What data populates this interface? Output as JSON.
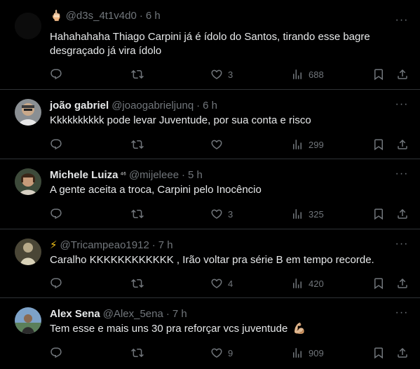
{
  "tweets": [
    {
      "prefix_emoji": "🖕🏻",
      "name": "",
      "handle": "@d3s_4t1v4d0",
      "time": "6 h",
      "text": "Hahahahaha Thiago Carpini já é ídolo do Santos, tirando esse bagre desgraçado já vira ídolo",
      "replies": "",
      "retweets": "",
      "likes": "3",
      "views": "688"
    },
    {
      "prefix_emoji": "",
      "name": "joão gabriel",
      "handle": "@joaogabrieljunq",
      "time": "6 h",
      "text": "Kkkkkkkkkk pode levar Juventude, por sua conta e risco",
      "replies": "",
      "retweets": "",
      "likes": "",
      "views": "299"
    },
    {
      "prefix_emoji": "",
      "name": "Michele Luiza",
      "name_suffix": "⁴⁶",
      "handle": "@mijeleee",
      "time": "5 h",
      "text": "A gente aceita a troca, Carpini pelo Inocêncio",
      "replies": "",
      "retweets": "",
      "likes": "3",
      "views": "325"
    },
    {
      "prefix_emoji": "⚡",
      "name": "",
      "handle": "@Tricampeao1912",
      "time": "7 h",
      "text": "Caralho KKKKKKKKKKKK , Irão voltar pra série B em tempo recorde.",
      "replies": "",
      "retweets": "",
      "likes": "4",
      "views": "420"
    },
    {
      "prefix_emoji": "",
      "name": "Alex Sena",
      "handle": "@Alex_5ena",
      "time": "7 h",
      "text": "Tem esse e mais uns 30 pra reforçar vcs juventude",
      "text_emoji": "💪🏼",
      "replies": "",
      "retweets": "",
      "likes": "9",
      "views": "909"
    }
  ],
  "dot": "·",
  "more_glyph": "···",
  "colors": {
    "background": "#000000",
    "text": "#e7e9ea",
    "secondary": "#71767b",
    "border": "#2f3336"
  },
  "icons": [
    "reply-icon",
    "retweet-icon",
    "like-icon",
    "views-icon",
    "bookmark-icon",
    "share-icon",
    "more-icon"
  ]
}
